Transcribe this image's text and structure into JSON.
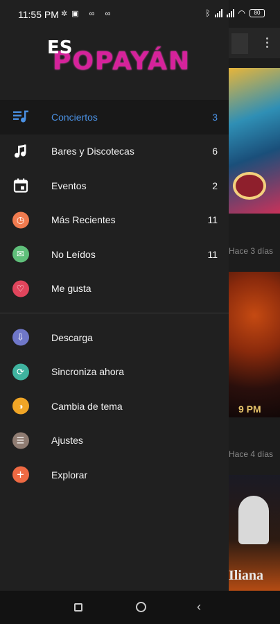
{
  "status_bar": {
    "time": "11:55 PM",
    "battery": "80"
  },
  "logo": {
    "prefix": "ES",
    "name": "POPAYÁN"
  },
  "menu": {
    "primary": [
      {
        "label": "Conciertos",
        "count": "3",
        "icon": "playlist-music-icon",
        "active": true
      },
      {
        "label": "Bares y Discotecas",
        "count": "6",
        "icon": "music-note-icon"
      },
      {
        "label": "Eventos",
        "count": "2",
        "icon": "calendar-icon"
      },
      {
        "label": "Más Recientes",
        "count": "11",
        "icon": "clock-icon",
        "color": "#f07b4f"
      },
      {
        "label": "No Leídos",
        "count": "11",
        "icon": "unread-mail-icon",
        "color": "#5fbf7a"
      },
      {
        "label": "Me gusta",
        "count": "",
        "icon": "heart-icon",
        "color": "#e0455c"
      }
    ],
    "secondary": [
      {
        "label": "Descarga",
        "icon": "download-icon",
        "color": "#6f77c9"
      },
      {
        "label": "Sincroniza ahora",
        "icon": "sync-icon",
        "color": "#3fb39f"
      },
      {
        "label": "Cambia de tema",
        "icon": "theme-icon",
        "color": "#f0a526"
      },
      {
        "label": "Ajustes",
        "icon": "settings-sliders-icon",
        "color": "#8f7c72"
      },
      {
        "label": "Explorar",
        "icon": "plus-icon",
        "color": "#ef6a43"
      }
    ]
  },
  "background": {
    "time_label_1": "Hace 3 días",
    "time_label_2": "Hace 4 días",
    "card2_text": "9 PM",
    "card3_text": "Iliana"
  },
  "colors": {
    "accent": "#4a90e2",
    "drawer_bg": "#202020",
    "logo_pink": "#d6229b"
  }
}
